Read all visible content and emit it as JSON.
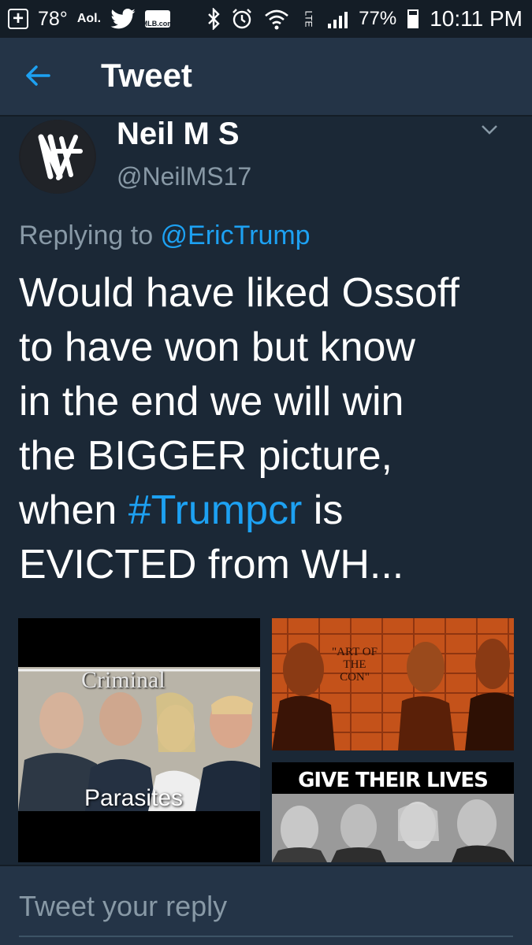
{
  "status_bar": {
    "temperature": "78°",
    "aol_label": "Aol.",
    "mlb_label": "MLB.com",
    "lte_label": "LTE",
    "battery": "77%",
    "time": "10:11 PM"
  },
  "header": {
    "title": "Tweet"
  },
  "tweet": {
    "author_name": "Neil M S",
    "author_handle": "@NeilMS17",
    "replying_prefix": "Replying to ",
    "replying_to": "@EricTrump",
    "text_line1": "Would have liked Ossoff",
    "text_line2": "to have won but know",
    "text_line3": "in the end we will win",
    "text_line4": "the BIGGER picture,",
    "text_line5_prefix": "when ",
    "hashtag": "#Trumpcr",
    "text_line5_suffix": " is",
    "text_line6": "EVICTED from WH..."
  },
  "media": {
    "image1_top_text": "Criminal",
    "image1_bottom_text": "Parasites",
    "image2_text_line1": "\"ART OF",
    "image2_text_line2": "THE CON\"",
    "image3_text": "GIVE THEIR LIVES"
  },
  "reply_bar": {
    "placeholder": "Tweet your reply"
  },
  "colors": {
    "background": "#1b2836",
    "bar": "#243447",
    "status_bar": "#141d26",
    "accent": "#1da1f2",
    "secondary_text": "#8899a6"
  },
  "icons": {
    "back": "arrow-left-icon",
    "caret": "chevron-down-icon",
    "bluetooth": "bluetooth-icon",
    "alarm": "alarm-clock-icon",
    "wifi": "wifi-icon",
    "twitter": "twitter-bird-icon"
  }
}
